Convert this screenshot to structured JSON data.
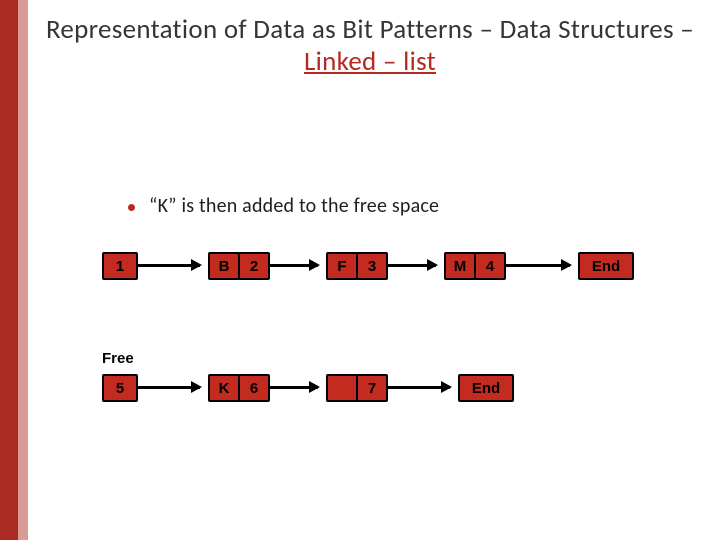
{
  "title": {
    "part1": "Representation of Data as Bit Patterns",
    "dash": " – ",
    "part2": "Data Structures",
    "part3": "Linked – list"
  },
  "bullet": {
    "text": "“K” is then added to the free space"
  },
  "row1": {
    "head": "1",
    "n1a": "B",
    "n1b": "2",
    "n2a": "F",
    "n2b": "3",
    "n3a": "M",
    "n3b": "4",
    "end": "End"
  },
  "row2": {
    "label": "Free",
    "head": "5",
    "n1a": "K",
    "n1b": "6",
    "n2b": "7",
    "end": "End"
  }
}
